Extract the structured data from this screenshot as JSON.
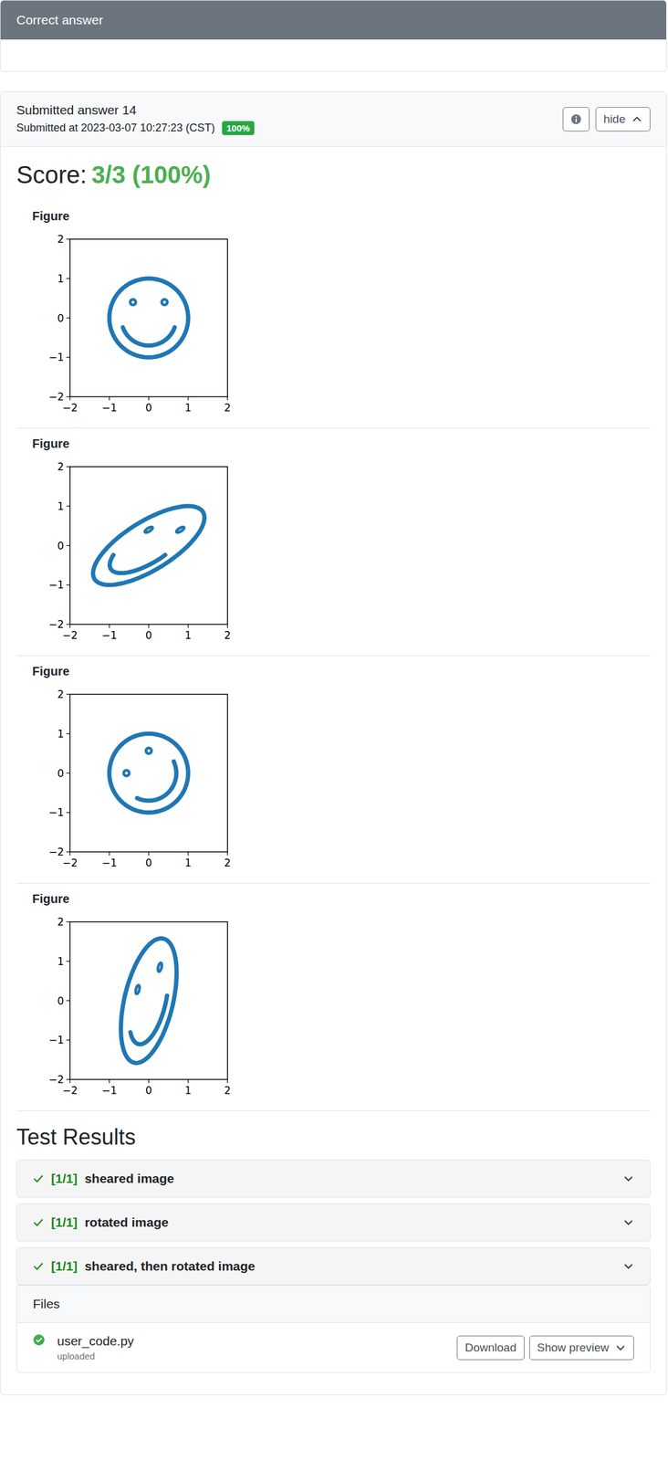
{
  "header": {
    "title": "Correct answer"
  },
  "submission": {
    "title": "Submitted answer 14",
    "submitted_at": "Submitted at 2023-03-07 10:27:23 (CST)",
    "badge": "100%",
    "toggle": "hide",
    "expanded": true
  },
  "score": {
    "label": "Score:",
    "value": "3/3 (100%)"
  },
  "shape": {
    "range": [
      -2,
      2
    ],
    "face_radius": 1,
    "eyes": [
      [
        -0.4,
        0.4
      ],
      [
        0.4,
        0.4
      ]
    ],
    "eye_radius": 0.07,
    "mouth_radius": 0.7,
    "mouth_angles": [
      200,
      340
    ]
  },
  "figures": [
    {
      "label": "Figure",
      "x_ticks": [
        "−2",
        "−1",
        "0",
        "1",
        "2"
      ],
      "y_ticks": [
        "−2",
        "−1",
        "0",
        "1",
        "2"
      ],
      "matrix": [
        [
          1,
          0
        ],
        [
          0,
          1
        ]
      ]
    },
    {
      "label": "Figure",
      "x_ticks": [
        "−2",
        "−1",
        "0",
        "1",
        "2"
      ],
      "y_ticks": [
        "−2",
        "−1",
        "0",
        "1",
        "2"
      ],
      "matrix": [
        [
          1,
          1
        ],
        [
          0,
          1
        ]
      ]
    },
    {
      "label": "Figure",
      "x_ticks": [
        "−2",
        "−1",
        "0",
        "1",
        "2"
      ],
      "y_ticks": [
        "−2",
        "−1",
        "0",
        "1",
        "2"
      ],
      "matrix": [
        [
          0.7071,
          -0.7071
        ],
        [
          0.7071,
          0.7071
        ]
      ]
    },
    {
      "label": "Figure",
      "x_ticks": [
        "−2",
        "−1",
        "0",
        "1",
        "2"
      ],
      "y_ticks": [
        "−2",
        "−1",
        "0",
        "1",
        "2"
      ],
      "matrix": [
        [
          0.7071,
          0
        ],
        [
          0.7071,
          1.4142
        ]
      ]
    }
  ],
  "test_results": {
    "title": "Test Results",
    "items": [
      {
        "score": "[1/1]",
        "name": "sheared image",
        "passed": true,
        "expanded": false
      },
      {
        "score": "[1/1]",
        "name": "rotated image",
        "passed": true,
        "expanded": false
      },
      {
        "score": "[1/1]",
        "name": "sheared, then rotated image",
        "passed": true,
        "expanded": false
      }
    ]
  },
  "files": {
    "title": "Files",
    "items": [
      {
        "name": "user_code.py",
        "status": "uploaded",
        "ok": true,
        "buttons": [
          "Download",
          "Show preview"
        ]
      }
    ]
  }
}
